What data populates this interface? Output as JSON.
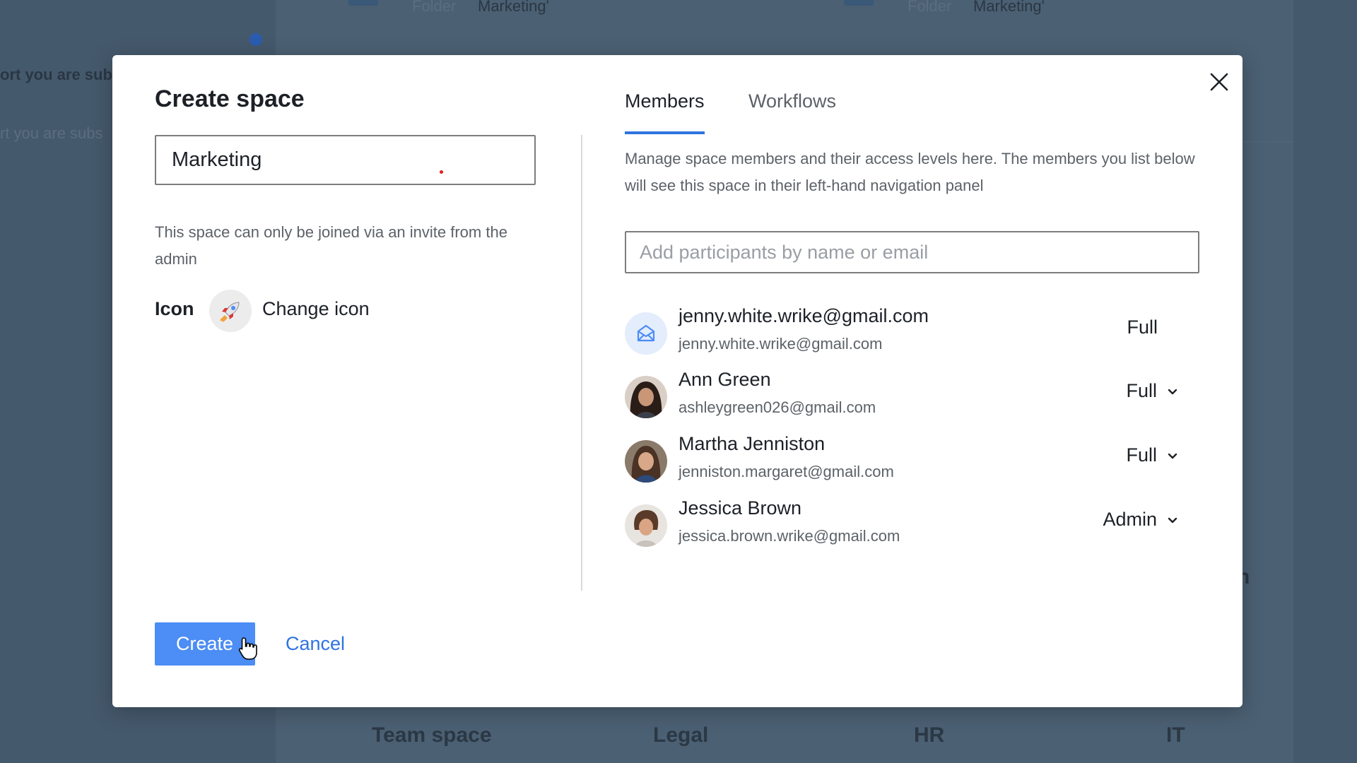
{
  "background": {
    "folder_label_1": "Folder",
    "folder_value_1": "Marketing'",
    "folder_label_2": "Folder",
    "folder_value_2": "Marketing'",
    "left_text_1": "ort you are sub",
    "left_text_2": "rt you are subs",
    "right_fragment": "n",
    "tabs": [
      "Team space",
      "Legal",
      "HR",
      "IT"
    ]
  },
  "modal": {
    "title": "Create space",
    "space_name_value": "Marketing",
    "invite_note": "This space can only be joined via an invite from the admin",
    "icon_label": "Icon",
    "icon_emoji": "🚀",
    "change_icon_label": "Change icon",
    "create_label": "Create",
    "cancel_label": "Cancel",
    "tabs": {
      "members": "Members",
      "workflows": "Workflows"
    },
    "description": "Manage space members and their access levels here. The members you list below will see this space in their left-hand navigation panel",
    "participants_placeholder": "Add participants by name or email",
    "members": [
      {
        "name": "jenny.white.wrike@gmail.com",
        "email": "jenny.white.wrike@gmail.com",
        "role": "Full",
        "avatar": "envelope-icon"
      },
      {
        "name": "Ann Green",
        "email": "ashleygreen026@gmail.com",
        "role": "Full",
        "avatar": "photo"
      },
      {
        "name": "Martha Jenniston",
        "email": "jenniston.margaret@gmail.com",
        "role": "Full",
        "avatar": "photo"
      },
      {
        "name": "Jessica Brown",
        "email": "jessica.brown.wrike@gmail.com",
        "role": "Admin",
        "avatar": "photo"
      }
    ]
  },
  "colors": {
    "primary": "#4c8df6",
    "link": "#2f74e0",
    "overlay": "#45596c"
  }
}
